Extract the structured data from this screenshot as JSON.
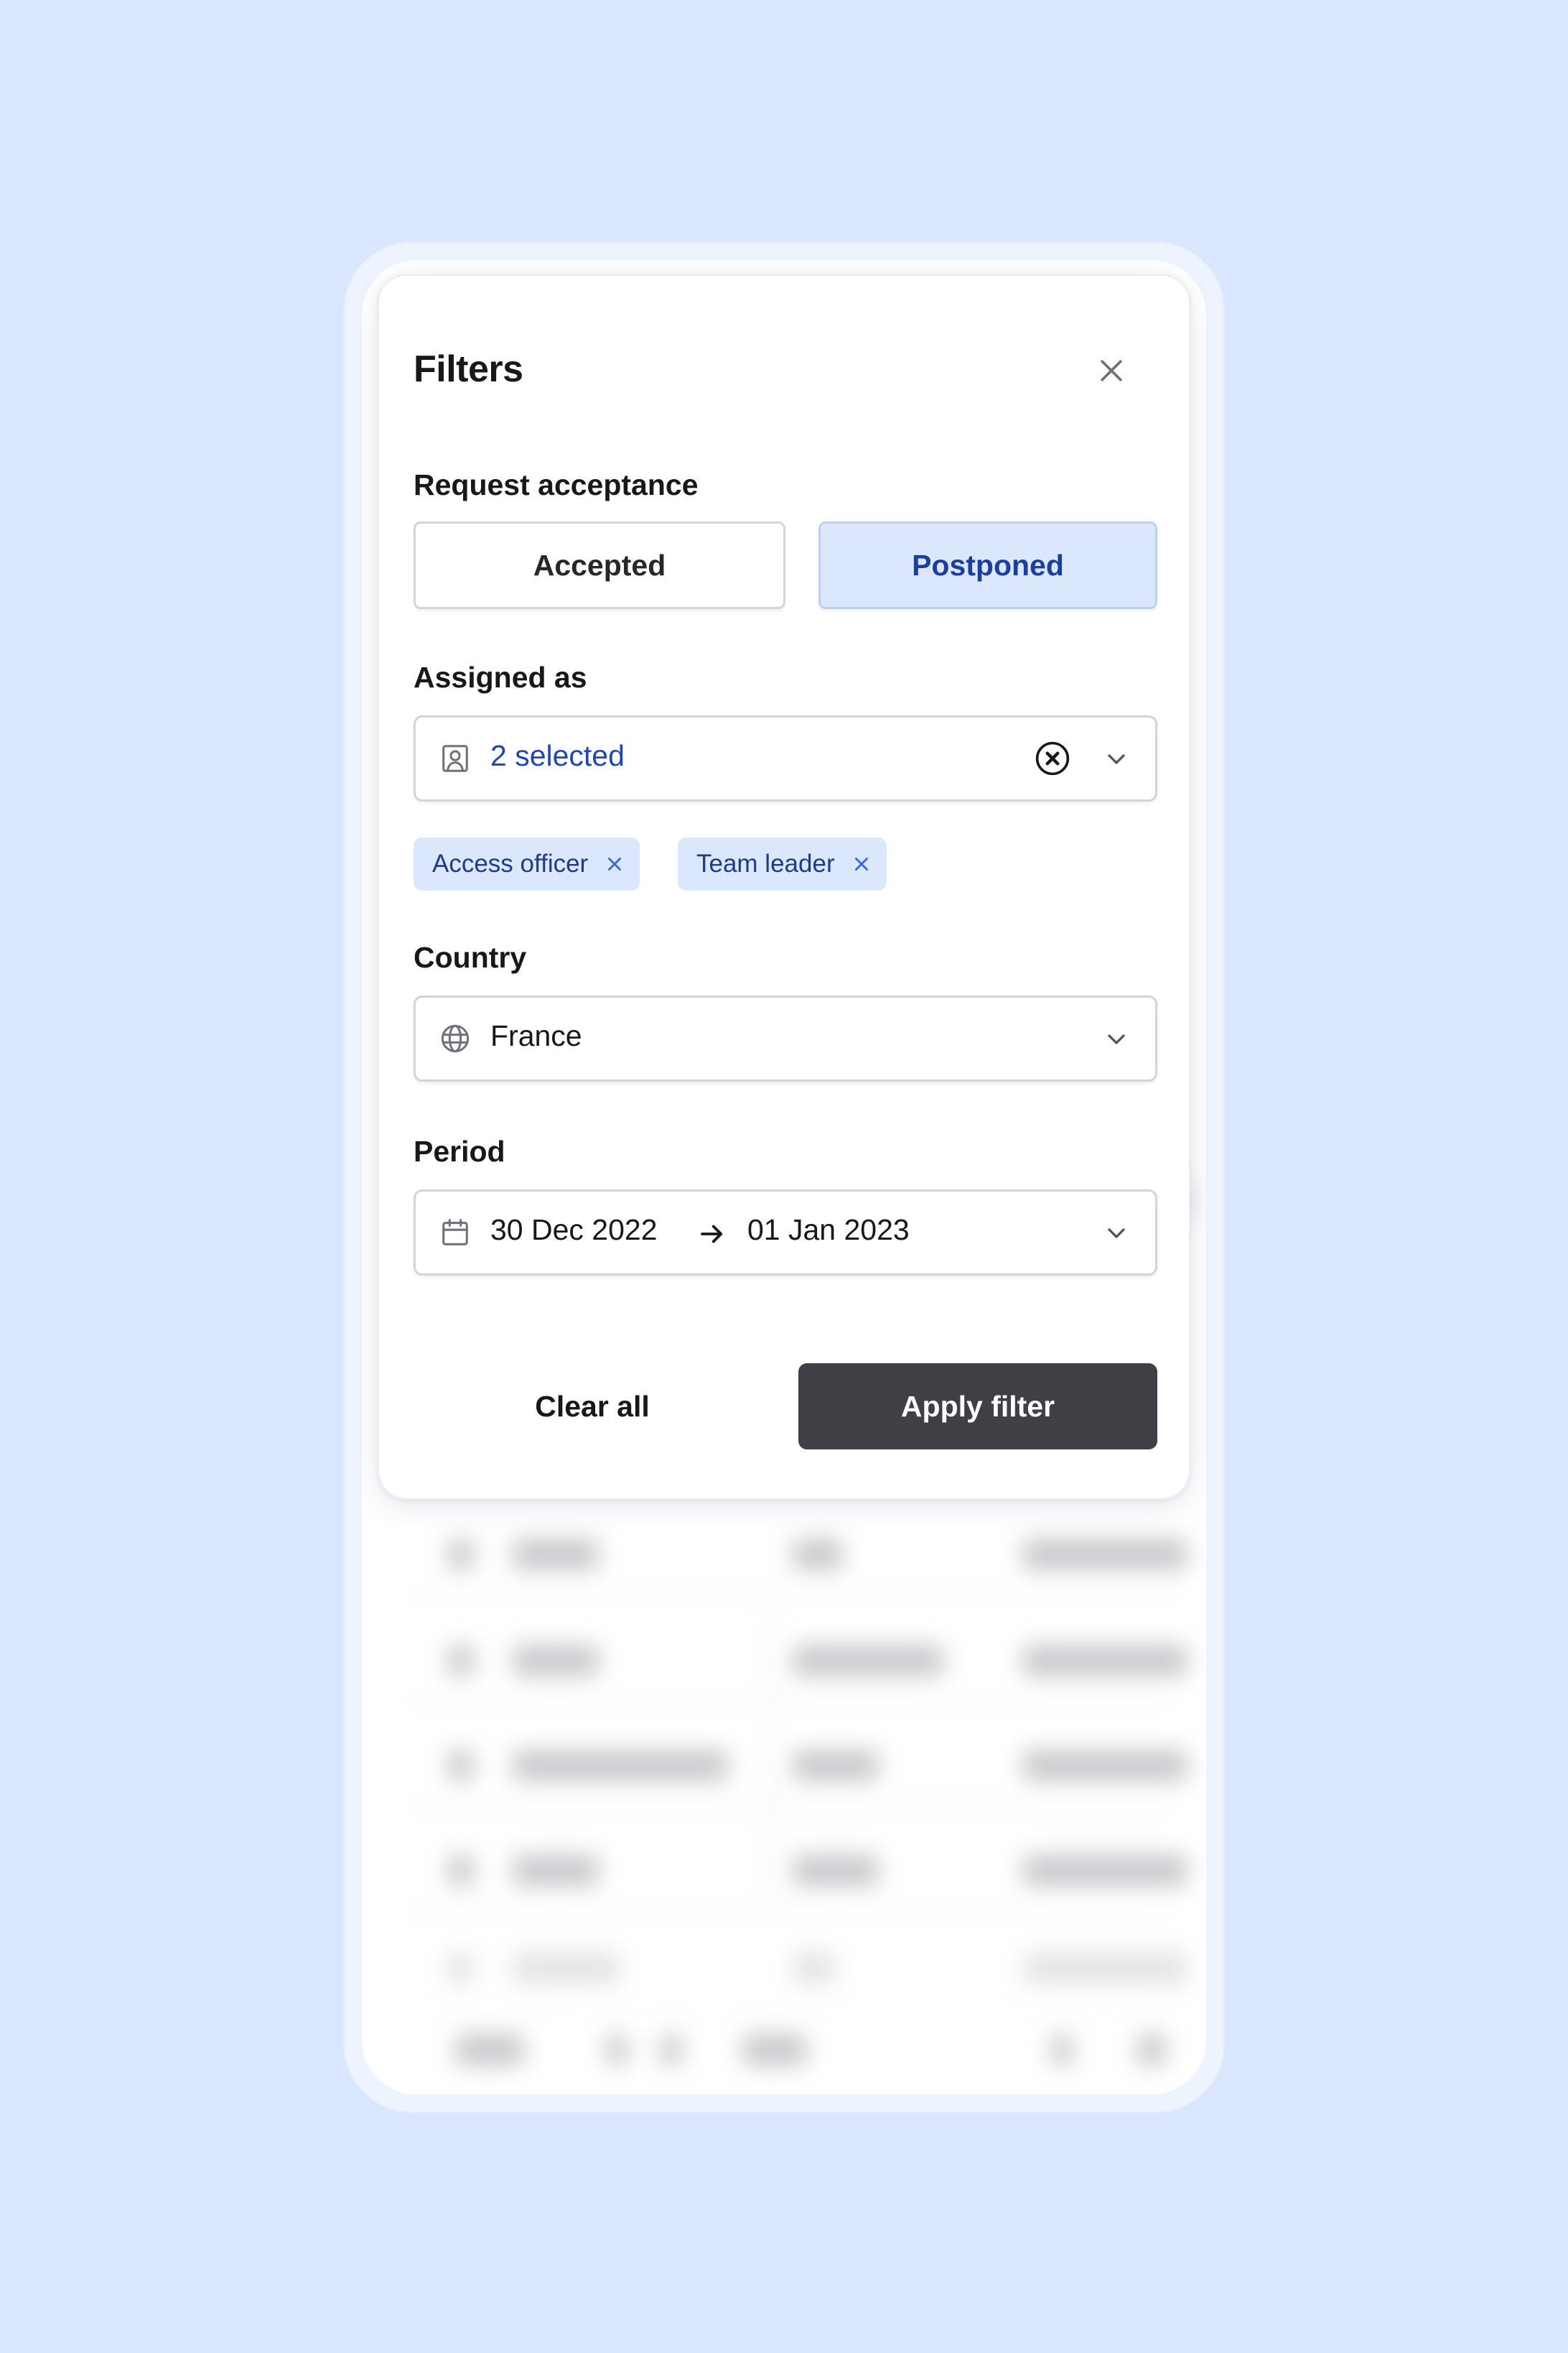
{
  "filters": {
    "title": "Filters",
    "request_acceptance": {
      "label": "Request acceptance",
      "options": [
        "Accepted",
        "Postponed"
      ],
      "selected": "Postponed"
    },
    "assigned_as": {
      "label": "Assigned as",
      "value": "2 selected",
      "chips": [
        "Access officer",
        "Team leader"
      ]
    },
    "country": {
      "label": "Country",
      "value": "France"
    },
    "period": {
      "label": "Period",
      "start": "30 Dec 2022",
      "end": "01 Jan 2023"
    },
    "clear_label": "Clear all",
    "apply_label": "Apply filter"
  },
  "icons": {
    "close": "close-icon",
    "user": "user-badge-icon",
    "clear": "clear-circle-icon",
    "chevron": "chevron-down-icon",
    "globe": "globe-icon",
    "calendar": "calendar-icon",
    "arrow": "arrow-right-icon",
    "chip_remove": "remove-x-icon"
  },
  "colors": {
    "background": "#d9e6fd",
    "accent": "#1e47b4",
    "selected_bg": "#dbe7fd",
    "primary_button": "#3f3f46"
  }
}
